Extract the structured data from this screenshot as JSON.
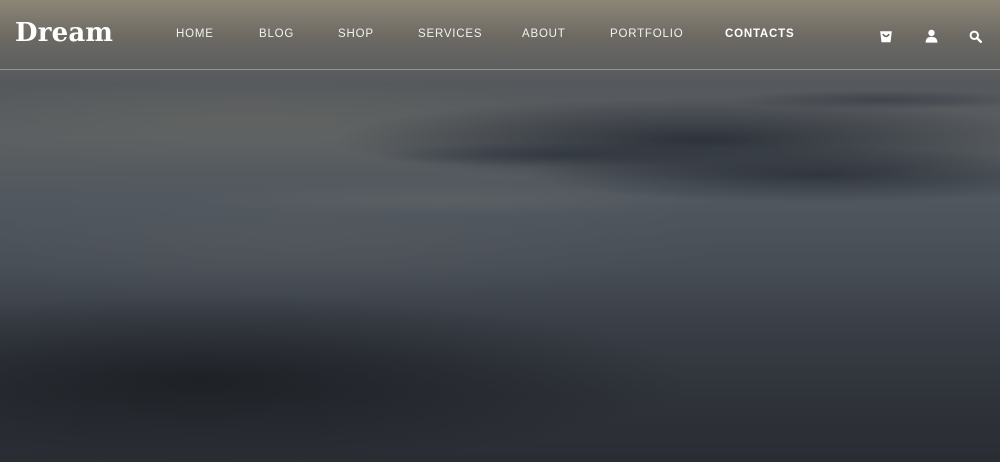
{
  "header": {
    "logo": "Dream",
    "nav": [
      {
        "label": "HOME",
        "active": false
      },
      {
        "label": "BLOG",
        "active": false
      },
      {
        "label": "SHOP",
        "active": false
      },
      {
        "label": "SERVICES",
        "active": false
      },
      {
        "label": "ABOUT",
        "active": false
      },
      {
        "label": "PORTFOLIO",
        "active": false
      },
      {
        "label": "CONTACTS",
        "active": true
      }
    ],
    "icons": {
      "cart": "shopping-bag-icon",
      "user": "user-icon",
      "search": "search-icon"
    }
  },
  "colors": {
    "nav_text": "#f1f1ec",
    "active_text": "#ffffff",
    "divider": "#dcdcd2"
  }
}
